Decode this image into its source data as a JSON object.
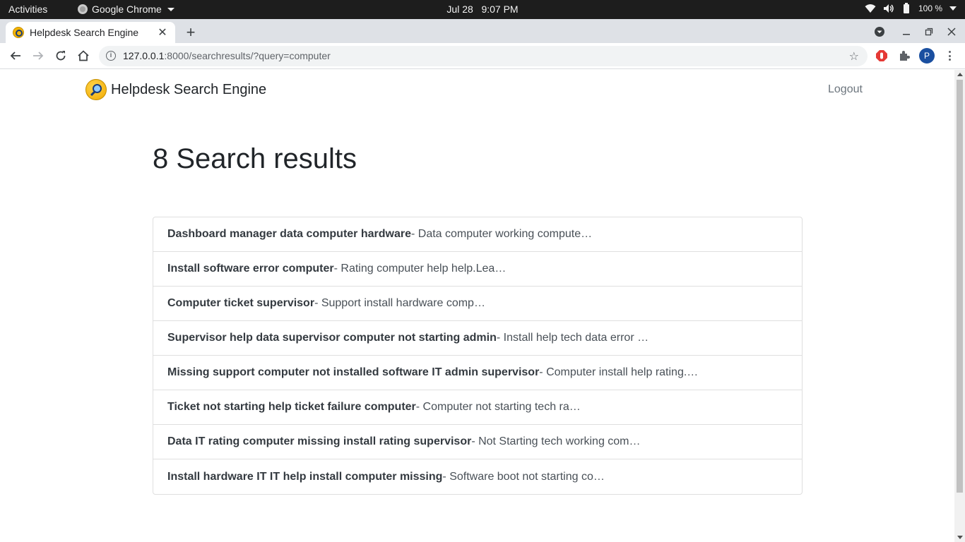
{
  "os_bar": {
    "activities": "Activities",
    "app_name": "Google Chrome",
    "date": "Jul 28",
    "time": "9:07 PM",
    "battery": "100 %"
  },
  "browser": {
    "tab_title": "Helpdesk Search Engine",
    "url_host": "127.0.0.1",
    "url_rest": ":8000/searchresults/?query=computer",
    "profile_initial": "P"
  },
  "site": {
    "brand": "Helpdesk Search Engine",
    "logout": "Logout",
    "heading": "8 Search results",
    "results": [
      {
        "title": "Dashboard manager data computer hardware",
        "snippet": " - Data computer working compute…"
      },
      {
        "title": "Install software error computer",
        "snippet": " - Rating computer help help.Lea…"
      },
      {
        "title": "Computer ticket supervisor",
        "snippet": " - Support install hardware comp…"
      },
      {
        "title": "Supervisor help data supervisor computer not starting admin",
        "snippet": " - Install help tech data error …"
      },
      {
        "title": "Missing support computer not installed software IT admin supervisor",
        "snippet": " - Computer install help rating.…"
      },
      {
        "title": "Ticket not starting help ticket failure computer",
        "snippet": " - Computer not starting tech ra…"
      },
      {
        "title": "Data IT rating computer missing install rating supervisor",
        "snippet": " - Not Starting tech working com…"
      },
      {
        "title": "Install hardware IT IT help install computer missing",
        "snippet": " - Software boot not starting co…"
      }
    ]
  }
}
